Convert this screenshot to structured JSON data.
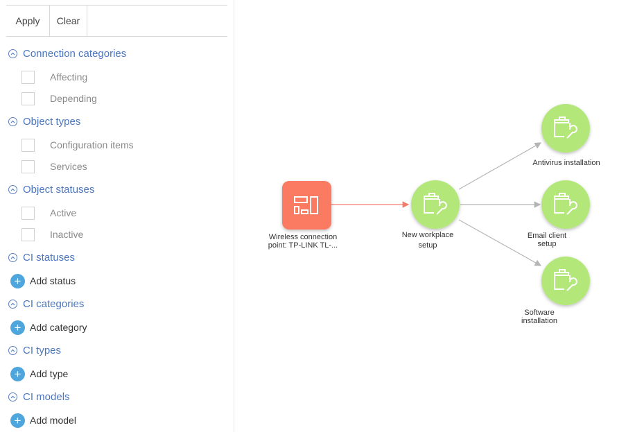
{
  "toolbar": {
    "apply_label": "Apply",
    "clear_label": "Clear"
  },
  "sections": {
    "connection_categories": {
      "title": "Connection categories",
      "items": [
        {
          "label": "Affecting"
        },
        {
          "label": "Depending"
        }
      ]
    },
    "object_types": {
      "title": "Object types",
      "items": [
        {
          "label": "Configuration items"
        },
        {
          "label": "Services"
        }
      ]
    },
    "object_statuses": {
      "title": "Object statuses",
      "items": [
        {
          "label": "Active"
        },
        {
          "label": "Inactive"
        }
      ]
    },
    "ci_statuses": {
      "title": "CI statuses",
      "add_label": "Add status"
    },
    "ci_categories": {
      "title": "CI categories",
      "add_label": "Add category"
    },
    "ci_types": {
      "title": "CI types",
      "add_label": "Add type"
    },
    "ci_models": {
      "title": "CI models",
      "add_label": "Add model"
    }
  },
  "graph": {
    "colors": {
      "config_item": "#fb7a62",
      "service": "#b3e77a",
      "edge_primary": "#f07c6c",
      "edge_secondary": "#b5b5b5"
    },
    "nodes": {
      "wireless": {
        "label_line1": "Wireless connection",
        "label_line2": "point: TP-LINK TL-...",
        "icon": "network-device-icon"
      },
      "workplace": {
        "label_line1": "New workplace",
        "label_line2": "setup",
        "icon": "briefcase-wrench-icon"
      },
      "antivirus": {
        "label_line1": "Antivirus installation",
        "icon": "briefcase-wrench-icon"
      },
      "email": {
        "label_line1": "Email client",
        "label_line2": "setup",
        "icon": "briefcase-wrench-icon"
      },
      "software": {
        "label_line1": "Software",
        "label_line2": "installation",
        "icon": "briefcase-wrench-icon"
      }
    }
  }
}
